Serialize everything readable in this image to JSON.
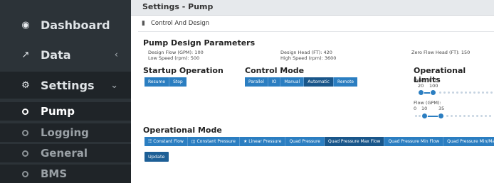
{
  "sidebar": {
    "items": [
      {
        "label": "Dashboard",
        "icon": "tachometer-icon"
      },
      {
        "label": "Data",
        "icon": "external-link-icon"
      },
      {
        "label": "Settings",
        "icon": "gear-icon"
      }
    ],
    "sub_items": [
      {
        "label": "Pump"
      },
      {
        "label": "Logging"
      },
      {
        "label": "General"
      },
      {
        "label": "BMS"
      }
    ]
  },
  "header": {
    "title": "Settings - Pump"
  },
  "panel": {
    "title": "Control And Design",
    "icon": "bar-chart-icon"
  },
  "design": {
    "heading": "Pump Design Parameters",
    "design_flow": "Design Flow (GPM): 100",
    "low_speed": "Low Speed (rpm): 500",
    "design_head": "Design Head (FT): 420",
    "high_speed": "High Speed (rpm): 3600",
    "zero_flow_head": "Zero Flow Head (FT): 150"
  },
  "startup": {
    "heading": "Startup Operation",
    "buttons": [
      "Resume",
      "Stop"
    ]
  },
  "control": {
    "heading": "Control Mode",
    "buttons": [
      "Parallel",
      "IO",
      "Manual",
      "Automatic",
      "Remote"
    ],
    "active": "Automatic"
  },
  "limits": {
    "heading": "Operational Limits",
    "head_label": "Head (FT):",
    "head_min": "20",
    "head_max": "100",
    "flow_label": "Flow (GPM):",
    "flow_zero": "0",
    "flow_min": "10",
    "flow_max": "35"
  },
  "mode": {
    "heading": "Operational Mode",
    "buttons": [
      "Constant Flow",
      "Constant Pressure",
      "Linear Pressure",
      "Quad Pressure",
      "Quad Pressure Max Flow",
      "Quad Pressure Min Flow",
      "Quad Pressure Min/Max Flow"
    ],
    "active": "Quad Pressure Max Flow"
  },
  "update_label": "Update",
  "colors": {
    "sidebar_bg": "#2c3338",
    "accent": "#2b7ec1",
    "active_btn": "#19568a"
  }
}
